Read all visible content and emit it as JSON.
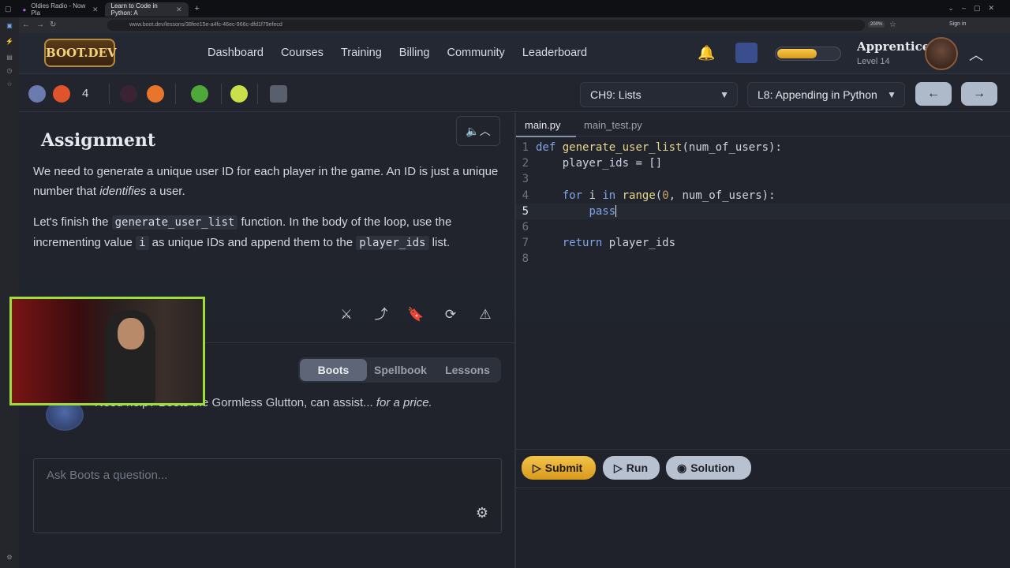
{
  "browser": {
    "tabs": [
      {
        "label": "Oldies Radio - Now Pla"
      },
      {
        "label": "Learn to Code in Python: A"
      }
    ],
    "url": "www.boot.dev/lessons/38fee15e-a4fc-46ec-966c-dfd1f79efecd",
    "zoom": "200%",
    "signin": "Sign in"
  },
  "header": {
    "logo_text": "BOOT.DEV",
    "nav": [
      "Dashboard",
      "Courses",
      "Training",
      "Billing",
      "Community",
      "Leaderboard"
    ],
    "rank": "Apprentice",
    "level": "Level 14",
    "xp_fraction": 0.62
  },
  "stats": {
    "gems": "4"
  },
  "lesson_nav": {
    "chapter": "CH9: Lists",
    "lesson": "L8: Appending in Python"
  },
  "assignment": {
    "title": "Assignment",
    "p1_a": "We need to generate a unique user ID for each player in the game. An ID is just a unique number that ",
    "p1_em": "identifies",
    "p1_b": " a user.",
    "p2_a": "Let's finish the ",
    "p2_code1": "generate_user_list",
    "p2_b": " function. In the body of the loop, use the incrementing value ",
    "p2_code2": "i",
    "p2_c": " as unique IDs and append them to the ",
    "p2_code3": "player_ids",
    "p2_d": " list."
  },
  "assistant": {
    "tabs": [
      "Boots",
      "Spellbook",
      "Lessons"
    ],
    "active_tab": "Boots",
    "message_a": "Need help? Boots the Gormless Glutton, can assist... ",
    "message_em": "for a price.",
    "ask_placeholder": "Ask Boots a question..."
  },
  "editor": {
    "tabs": [
      "main.py",
      "main_test.py"
    ],
    "active_tab": "main.py",
    "lines": [
      "def generate_user_list(num_of_users):",
      "    player_ids = []",
      "",
      "    for i in range(0, num_of_users):",
      "        pass",
      "",
      "    return player_ids",
      ""
    ],
    "current_line": 5,
    "buttons": {
      "submit": "Submit",
      "run": "Run",
      "solution": "Solution"
    }
  }
}
